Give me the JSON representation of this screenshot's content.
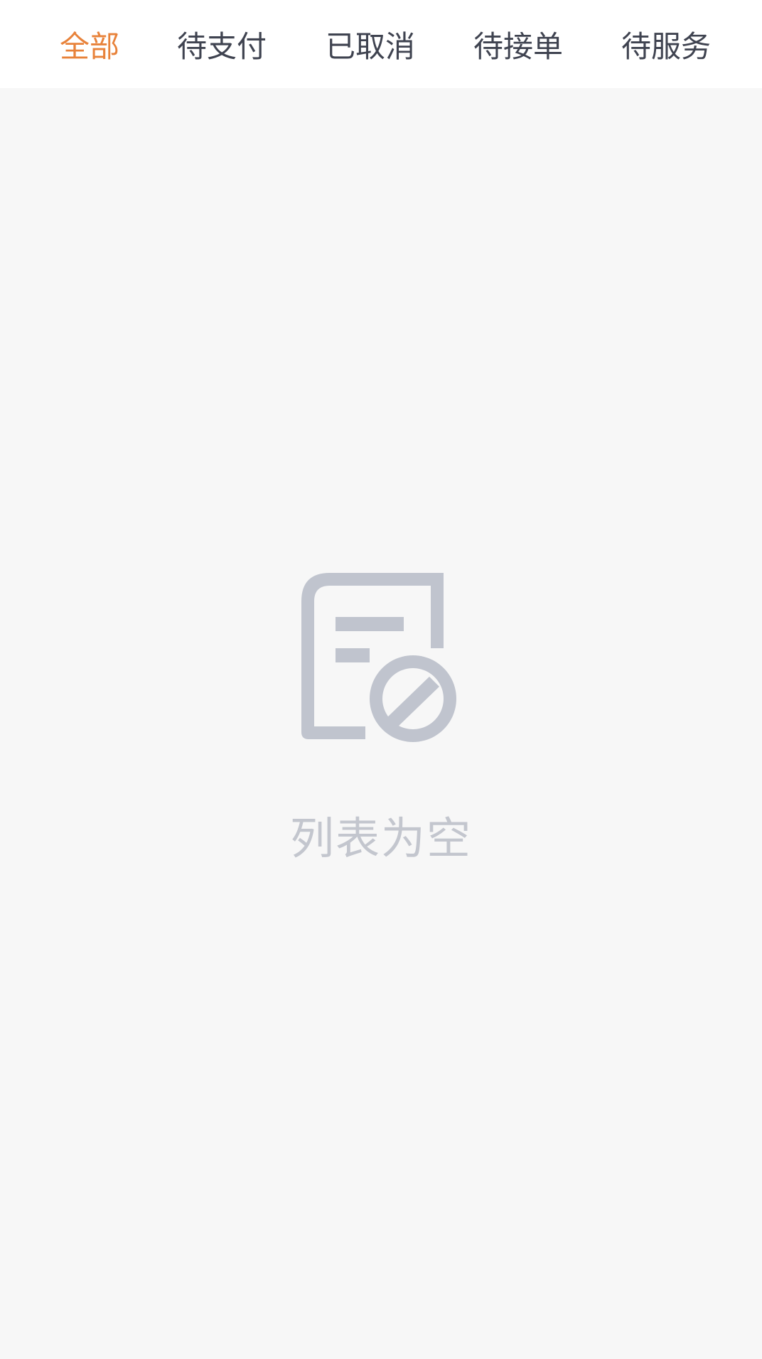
{
  "tabs": [
    {
      "label": "全部",
      "active": true
    },
    {
      "label": "待支付",
      "active": false
    },
    {
      "label": "已取消",
      "active": false
    },
    {
      "label": "待接单",
      "active": false
    },
    {
      "label": "待服务",
      "active": false
    }
  ],
  "empty_state": {
    "message": "列表为空",
    "icon": "empty-list-icon"
  },
  "colors": {
    "active_tab": "#e8823a",
    "tab_text": "#3f4350",
    "icon": "#c0c4ce",
    "empty_text": "#c3c6ce",
    "background": "#f7f7f7",
    "header_bg": "#ffffff"
  }
}
